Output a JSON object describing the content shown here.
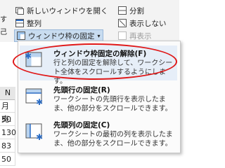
{
  "ribbon": {
    "new_window": "新しいウィンドウを開く",
    "split": "分割",
    "arrange": "整列",
    "hide": "表示しない",
    "freeze_panes": "ウィンドウ枠の固定",
    "unhide": "再表示",
    "left_labels": [
      "す",
      "己"
    ]
  },
  "sheet": {
    "column_header": "N",
    "cells": [
      "月 売.",
      "50",
      "130",
      "83",
      "50"
    ]
  },
  "menu": {
    "items": [
      {
        "title": "ウィンドウ枠固定の解除(F)",
        "desc": "行と列の固定を解除して、ワークシート全体をスクロールするようにします。"
      },
      {
        "title": "先頭行の固定(R)",
        "desc": "ワークシートの先頭行を表示したまま、他の部分をスクロールできます。"
      },
      {
        "title": "先頭列の固定(C)",
        "desc": "ワークシートの最初の列を表示したまま、他の部分をスクロールできます。"
      }
    ]
  },
  "colors": {
    "highlight": "#e6eef8",
    "annotation_ring": "#e01818",
    "icon_blue": "#2b6cc4"
  }
}
